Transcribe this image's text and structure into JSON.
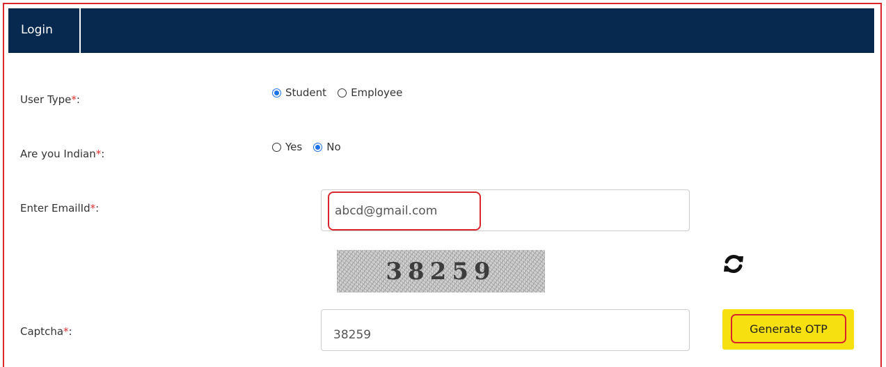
{
  "header": {
    "tab_label": "Login"
  },
  "form": {
    "user_type": {
      "label": "User Type",
      "required_mark": "*",
      "colon": ":",
      "options": [
        "Student",
        "Employee"
      ],
      "selected": "Student"
    },
    "indian": {
      "label": "Are you Indian",
      "required_mark": "*",
      "colon": ":",
      "options": [
        "Yes",
        "No"
      ],
      "selected": "No"
    },
    "email": {
      "label": "Enter EmailId",
      "required_mark": "*",
      "colon": ":",
      "value": "abcd@gmail.com"
    },
    "captcha": {
      "label": "Captcha",
      "required_mark": "*",
      "colon": ":",
      "image_text": "38259",
      "value": "38259"
    },
    "generate_otp_label": "Generate OTP"
  },
  "icons": {
    "refresh": "refresh-icon"
  },
  "colors": {
    "header_bg": "#08294f",
    "required": "#e0312f",
    "highlight": "#d9262c",
    "otp_bg": "#f7e010",
    "radio_checked": "#1a73e8"
  }
}
